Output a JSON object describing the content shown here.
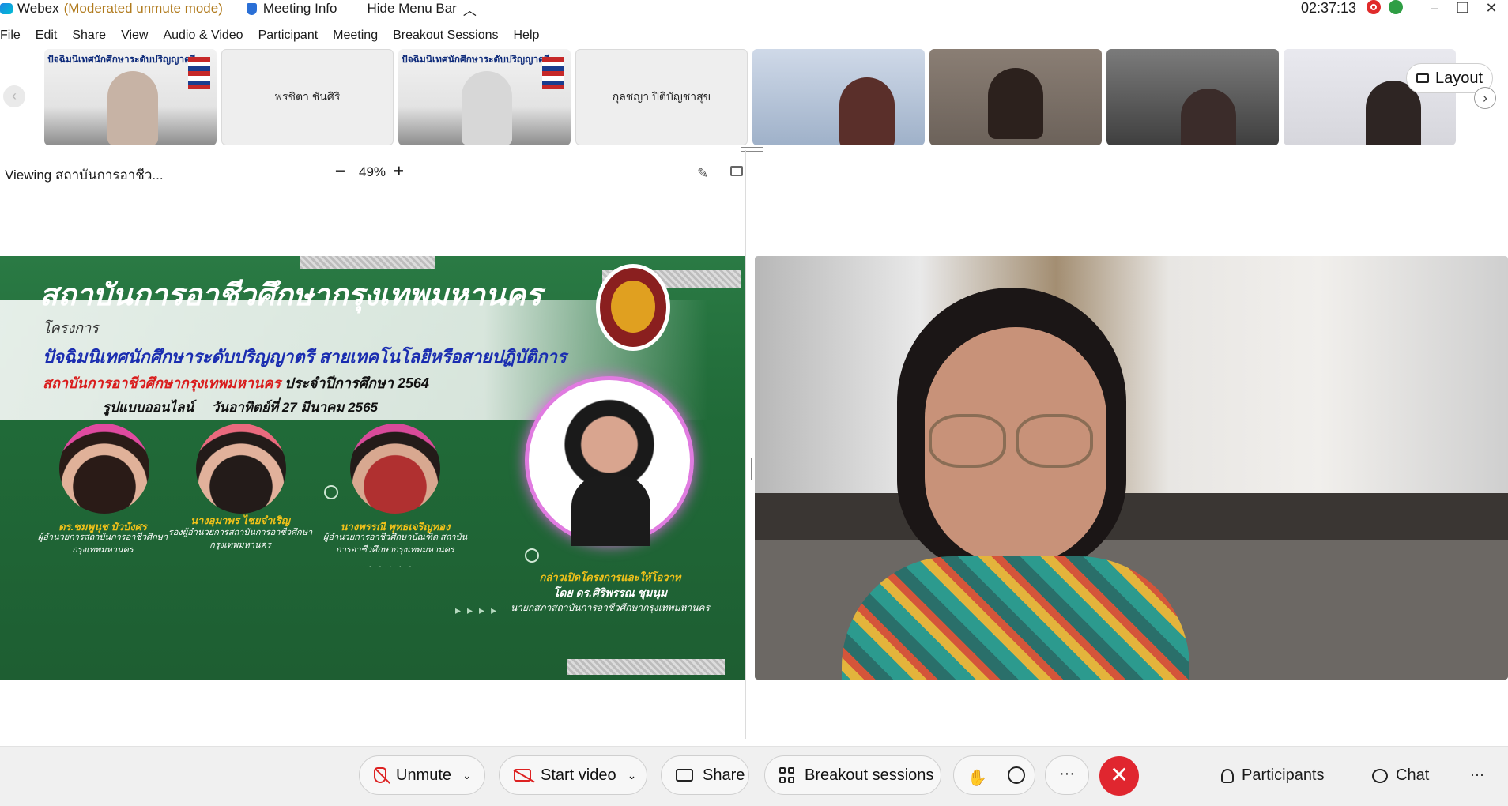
{
  "titlebar": {
    "app": "Webex",
    "mode": "(Moderated unmute mode)",
    "meeting_info": "Meeting Info",
    "hide_menu": "Hide Menu Bar",
    "clock": "02:37:13"
  },
  "menu": [
    "File",
    "Edit",
    "Share",
    "View",
    "Audio & Video",
    "Participant",
    "Meeting",
    "Breakout Sessions",
    "Help"
  ],
  "thumbs": {
    "t2_name": "พรชิตา ชันศิริ",
    "t4_name": "กุลชญา ปิติบัญชาสุข",
    "t1_title": "ปัจฉิมนิเทศนักศึกษาระดับปริญญาตรี",
    "t3_title": "ปัจฉิมนิเทศนักศึกษาระดับปริญญาตรี"
  },
  "layout_label": "Layout",
  "viewer": {
    "viewing": "Viewing สถาบันการอาชีว...",
    "zoom": "49%"
  },
  "slide": {
    "header": "สถาบันการอาชีวศึกษากรุงเทพมหานคร",
    "project": "โครงการ",
    "line1": "ปัจฉิมนิเทศนักศึกษาระดับปริญญาตรี สายเทคโนโลยีหรือสายปฏิบัติการ",
    "line2_red": "สถาบันการอาชีวศึกษากรุงเทพมหานคร",
    "line2_black": "ประจำปีการศึกษา 2564",
    "format": "รูปแบบออนไลน์",
    "date": "วันอาทิตย์ที่ 27 มีนาคม 2565",
    "speakers": [
      {
        "name": "ดร.ชมพูนุช บัวบังศร",
        "role": "ผู้อำนวยการสถาบันการอาชีวศึกษา กรุงเทพมหานคร"
      },
      {
        "name": "นางอุมาพร ไชยจำเริญ",
        "role": "รองผู้อำนวยการสถาบันการอาชีวศึกษา กรุงเทพมหานคร"
      },
      {
        "name": "นางพรรณี พุทธเจริญทอง",
        "role": "ผู้อำนวยการอาชีวศึกษาบัณฑิต สถาบันการอาชีวศึกษากรุงเทพมหานคร"
      }
    ],
    "opening": "กล่าวเปิดโครงการและให้โอวาท",
    "by": "โดย ดร.ศิริพรรณ ชุมนุม",
    "chair": "นายกสภาสถาบันการอาชีวศึกษากรุงเทพมหานคร"
  },
  "bottom": {
    "unmute": "Unmute",
    "start_video": "Start video",
    "share": "Share",
    "breakout": "Breakout sessions",
    "more": "···",
    "participants": "Participants",
    "chat": "Chat",
    "overflow": "···"
  }
}
